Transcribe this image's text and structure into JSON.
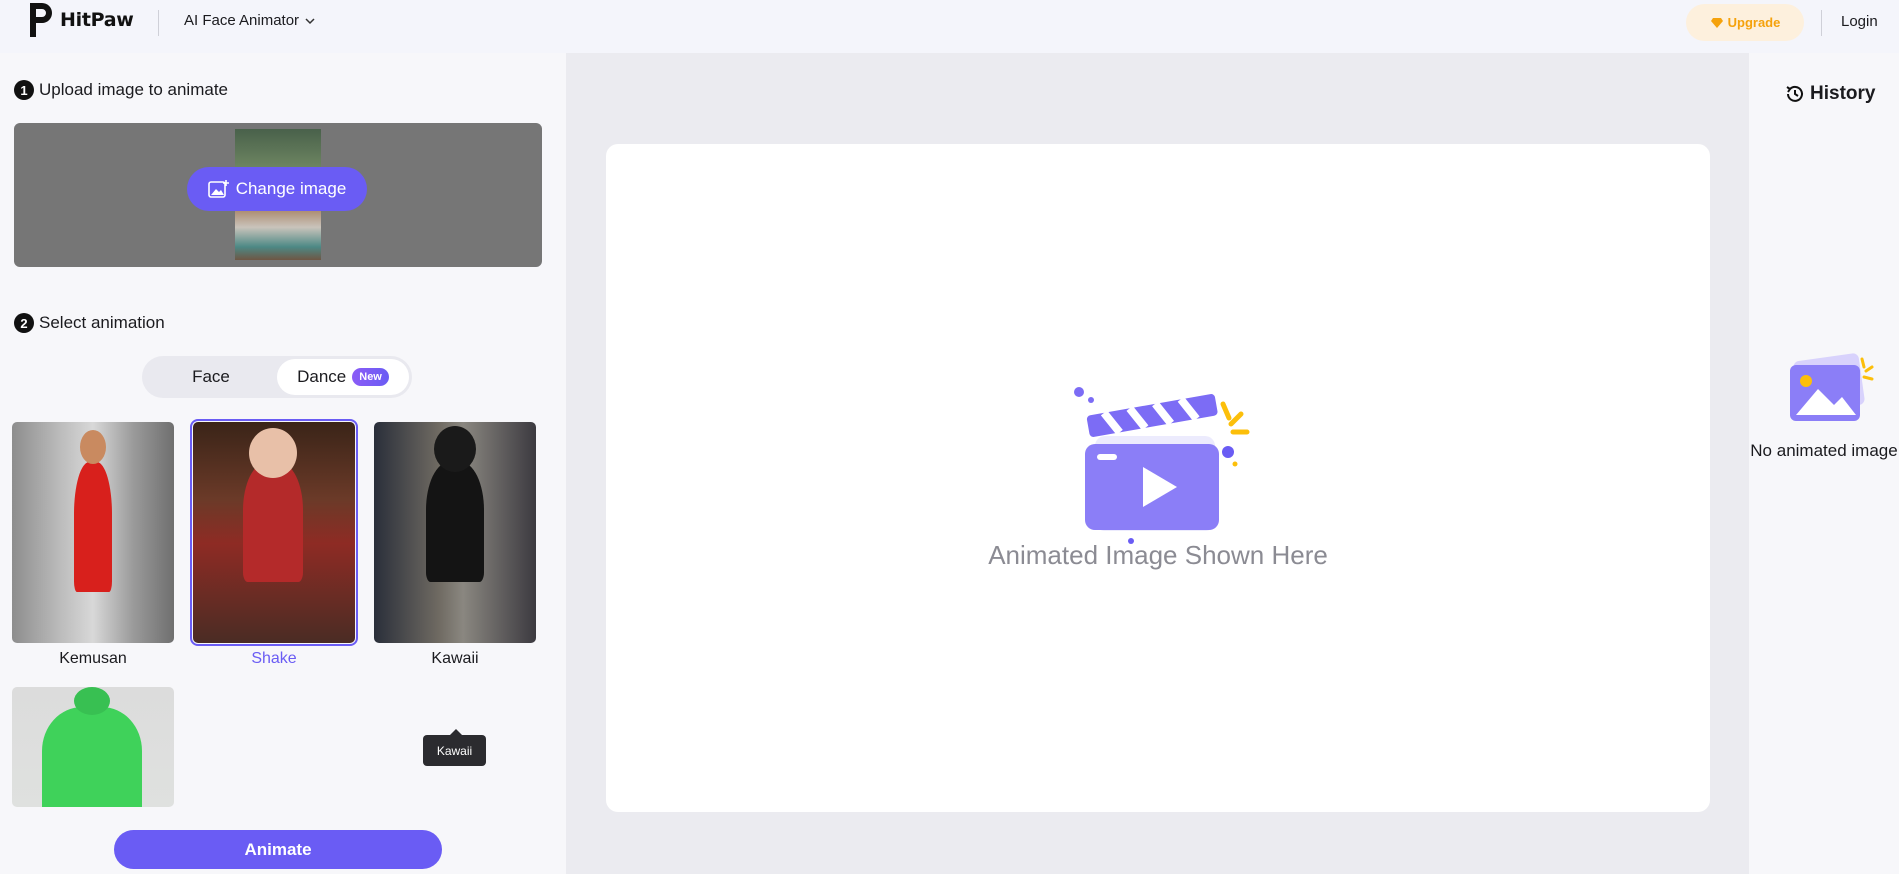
{
  "header": {
    "brand": "HitPaw",
    "product": "AI Face Animator",
    "upgrade_label": "Upgrade",
    "login_label": "Login"
  },
  "left": {
    "step1": {
      "num": "1",
      "title": "Upload image to animate"
    },
    "change_image_label": "Change image",
    "step2": {
      "num": "2",
      "title": "Select animation"
    },
    "tabs": [
      {
        "label": "Face",
        "active": false
      },
      {
        "label": "Dance",
        "active": true,
        "badge": "New"
      }
    ],
    "animations": [
      {
        "label": "Kemusan",
        "selected": false
      },
      {
        "label": "Shake",
        "selected": true
      },
      {
        "label": "Kawaii",
        "selected": false
      },
      {
        "label": "",
        "selected": false
      }
    ],
    "tooltip": "Kawaii",
    "animate_label": "Animate"
  },
  "center": {
    "placeholder": "Animated Image Shown Here"
  },
  "right": {
    "history_label": "History",
    "empty_text": "No animated image"
  },
  "colors": {
    "accent": "#6a5cf4",
    "upgrade": "#f5a20c",
    "upgrade_bg": "#fdf0dd"
  }
}
